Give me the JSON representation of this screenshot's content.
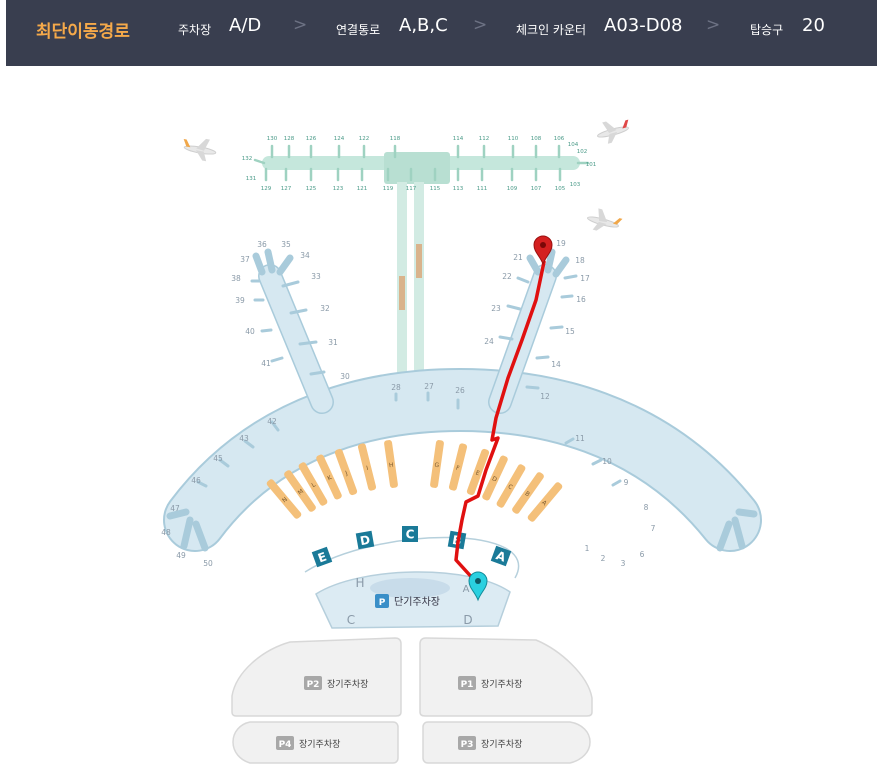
{
  "header": {
    "title": "최단이동경로",
    "items": [
      {
        "label": "주차장",
        "value": "A/D"
      },
      {
        "label": "연결통로",
        "value": "A,B,C"
      },
      {
        "label": "체크인 카운터",
        "value": "A03-D08"
      },
      {
        "label": "탑승구",
        "value": "20"
      }
    ],
    "separator": ">"
  },
  "map": {
    "concourse_gates_top": [
      "130",
      "128",
      "126",
      "124",
      "122",
      "118",
      "114",
      "112",
      "110",
      "108",
      "106",
      "104",
      "102"
    ],
    "concourse_gates_bottom": [
      "131",
      "129",
      "127",
      "125",
      "123",
      "121",
      "119",
      "117",
      "115",
      "113",
      "111",
      "109",
      "107",
      "105",
      "103"
    ],
    "concourse_gates_side": [
      "132",
      "101"
    ],
    "gates_left_pier": [
      "37",
      "36",
      "35",
      "34",
      "38",
      "33",
      "39",
      "32",
      "40",
      "31",
      "41",
      "30"
    ],
    "gates_right_pier": [
      "21",
      "19",
      "18",
      "22",
      "17",
      "16",
      "23",
      "15",
      "24",
      "14",
      "12"
    ],
    "gates_center": [
      "28",
      "27",
      "26"
    ],
    "gates_main_left": [
      "42",
      "43",
      "45",
      "46",
      "47",
      "48",
      "49",
      "50"
    ],
    "gates_main_right": [
      "11",
      "10",
      "9",
      "8",
      "7",
      "6",
      "3",
      "2",
      "1"
    ],
    "checkin_rows": [
      "N",
      "M",
      "L",
      "K",
      "J",
      "I",
      "H",
      "G",
      "F",
      "E",
      "D",
      "C",
      "B",
      "A"
    ],
    "entrances": [
      "E",
      "D",
      "C",
      "B",
      "A"
    ],
    "short_term_parking": {
      "badge": "P",
      "label": "단기주차장",
      "zones": [
        "H",
        "C",
        "D",
        "A"
      ]
    },
    "long_term_parking": [
      {
        "badge": "P2",
        "label": "장기주차장"
      },
      {
        "badge": "P1",
        "label": "장기주차장"
      },
      {
        "badge": "P4",
        "label": "장기주차장"
      },
      {
        "badge": "P3",
        "label": "장기주차장"
      }
    ],
    "colors": {
      "header_bg": "#393e4f",
      "title": "#f5a94a",
      "terminal": "#d6e8f1",
      "concourse": "#bfe4d8",
      "checkin": "#f4c07a",
      "entrance": "#1a7a98",
      "route": "#e01010",
      "end_marker": "#d42020",
      "start_marker": "#2ad0e0"
    }
  }
}
